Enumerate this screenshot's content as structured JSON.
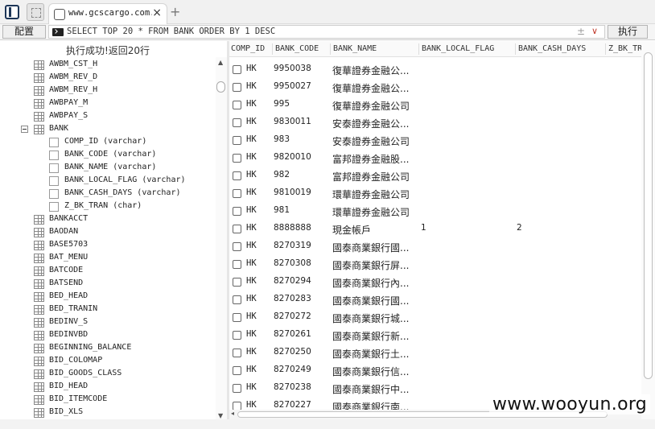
{
  "tab": {
    "title": "www.gcscargo.com.tw"
  },
  "toolbar": {
    "config_label": "配置",
    "sql": "SELECT TOP 20 * FROM BANK ORDER BY 1 DESC",
    "sql_icon": "command-prompt-icon",
    "execute_label": "执行",
    "plusminus": "±",
    "dropdown": "∨"
  },
  "status": "执行成功!返回20行",
  "tree": {
    "items": [
      {
        "label": "AWBM_CST_H",
        "kind": "table"
      },
      {
        "label": "AWBM_REV_D",
        "kind": "table"
      },
      {
        "label": "AWBM_REV_H",
        "kind": "table"
      },
      {
        "label": "AWBPAY_M",
        "kind": "table"
      },
      {
        "label": "AWBPAY_S",
        "kind": "table"
      },
      {
        "label": "BANK",
        "kind": "table",
        "expanded": true
      },
      {
        "label": "COMP_ID (varchar)",
        "kind": "column"
      },
      {
        "label": "BANK_CODE (varchar)",
        "kind": "column"
      },
      {
        "label": "BANK_NAME (varchar)",
        "kind": "column"
      },
      {
        "label": "BANK_LOCAL_FLAG (varchar)",
        "kind": "column"
      },
      {
        "label": "BANK_CASH_DAYS (varchar)",
        "kind": "column"
      },
      {
        "label": "Z_BK_TRAN (char)",
        "kind": "column"
      },
      {
        "label": "BANKACCT",
        "kind": "table"
      },
      {
        "label": "BAODAN",
        "kind": "table"
      },
      {
        "label": "BASE5703",
        "kind": "table"
      },
      {
        "label": "BAT_MENU",
        "kind": "table"
      },
      {
        "label": "BATCODE",
        "kind": "table"
      },
      {
        "label": "BATSEND",
        "kind": "table"
      },
      {
        "label": "BED_HEAD",
        "kind": "table"
      },
      {
        "label": "BED_TRANIN",
        "kind": "table"
      },
      {
        "label": "BEDINV_S",
        "kind": "table"
      },
      {
        "label": "BEDINVBD",
        "kind": "table"
      },
      {
        "label": "BEGINNING_BALANCE",
        "kind": "table"
      },
      {
        "label": "BID_COLOMAP",
        "kind": "table"
      },
      {
        "label": "BID_GOODS_CLASS",
        "kind": "table"
      },
      {
        "label": "BID_HEAD",
        "kind": "table"
      },
      {
        "label": "BID_ITEMCODE",
        "kind": "table"
      },
      {
        "label": "BID_XLS",
        "kind": "table"
      }
    ]
  },
  "grid": {
    "columns": [
      "COMP_ID",
      "BANK_CODE",
      "BANK_NAME",
      "BANK_LOCAL_FLAG",
      "BANK_CASH_DAYS",
      "Z_BK_TR"
    ],
    "rows": [
      [
        "HK",
        "9950038",
        "復華證券金融公...",
        "",
        ""
      ],
      [
        "HK",
        "9950027",
        "復華證券金融公...",
        "",
        ""
      ],
      [
        "HK",
        "995",
        "復華證券金融公司",
        "",
        ""
      ],
      [
        "HK",
        "9830011",
        "安泰證券金融公...",
        "",
        ""
      ],
      [
        "HK",
        "983",
        "安泰證券金融公司",
        "",
        ""
      ],
      [
        "HK",
        "9820010",
        "富邦證券金融股...",
        "",
        ""
      ],
      [
        "HK",
        "982",
        "富邦證券金融公司",
        "",
        ""
      ],
      [
        "HK",
        "9810019",
        "環華證券金融公司",
        "",
        ""
      ],
      [
        "HK",
        "981",
        "環華證券金融公司",
        "",
        ""
      ],
      [
        "HK",
        "8888888",
        "現金帳戶",
        "1",
        "2"
      ],
      [
        "HK",
        "8270319",
        "國泰商業銀行國...",
        "",
        ""
      ],
      [
        "HK",
        "8270308",
        "國泰商業銀行屏...",
        "",
        ""
      ],
      [
        "HK",
        "8270294",
        "國泰商業銀行內...",
        "",
        ""
      ],
      [
        "HK",
        "8270283",
        "國泰商業銀行國...",
        "",
        ""
      ],
      [
        "HK",
        "8270272",
        "國泰商業銀行城...",
        "",
        ""
      ],
      [
        "HK",
        "8270261",
        "國泰商業銀行新...",
        "",
        ""
      ],
      [
        "HK",
        "8270250",
        "國泰商業銀行土...",
        "",
        ""
      ],
      [
        "HK",
        "8270249",
        "國泰商業銀行信...",
        "",
        ""
      ],
      [
        "HK",
        "8270238",
        "國泰商業銀行中...",
        "",
        ""
      ],
      [
        "HK",
        "8270227",
        "國泰商業銀行南...",
        "",
        ""
      ]
    ]
  },
  "watermark": "www.wooyun.org"
}
